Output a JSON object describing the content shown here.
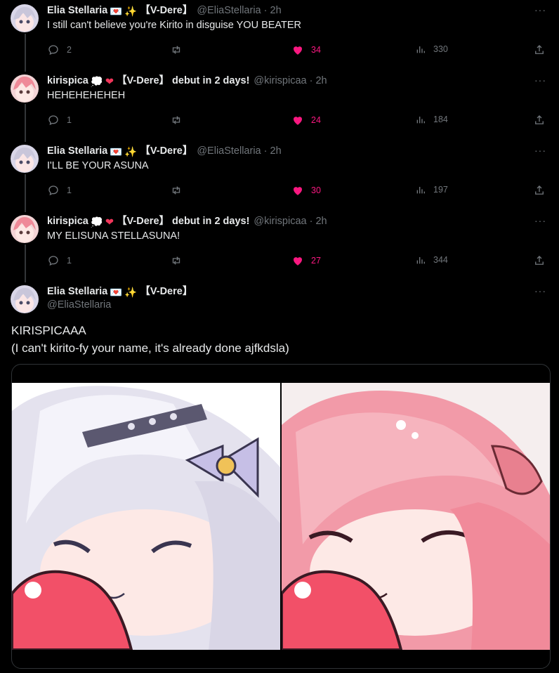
{
  "replies": [
    {
      "name": "Elia Stellaria",
      "emojis": [
        "💌",
        "✨"
      ],
      "tag": "【V-Dere】",
      "handle": "@EliaStellaria",
      "time": "2h",
      "text": "I still can't believe you're Kirito in disguise YOU BEATER",
      "replies": "2",
      "reposts": "",
      "likes": "34",
      "views": "330"
    },
    {
      "name": "kirispica",
      "emojis": [
        "💭",
        "❤"
      ],
      "tag": "【V-Dere】 debut in 2 days!",
      "handle": "@kirispicaa",
      "time": "2h",
      "text": "HEHEHEHEHEH",
      "replies": "1",
      "reposts": "",
      "likes": "24",
      "views": "184"
    },
    {
      "name": "Elia Stellaria",
      "emojis": [
        "💌",
        "✨"
      ],
      "tag": "【V-Dere】",
      "handle": "@EliaStellaria",
      "time": "2h",
      "text": "I'LL BE YOUR ASUNA",
      "replies": "1",
      "reposts": "",
      "likes": "30",
      "views": "197"
    },
    {
      "name": "kirispica",
      "emojis": [
        "💭",
        "❤"
      ],
      "tag": "【V-Dere】 debut in 2 days!",
      "handle": "@kirispicaa",
      "time": "2h",
      "text": "MY ELISUNA STELLASUNA!",
      "replies": "1",
      "reposts": "",
      "likes": "27",
      "views": "344"
    }
  ],
  "main": {
    "name": "Elia Stellaria",
    "emojis": [
      "💌",
      "✨"
    ],
    "tag": "【V-Dere】",
    "handle": "@EliaStellaria",
    "text_line1": "KIRISPICAAA",
    "text_line2": "(I can't kirito-fy your name, it's already done ajfkdsla)"
  },
  "more_glyph": "···",
  "dot": "·",
  "colors": {
    "like": "#f91880",
    "muted": "#71767b",
    "divider": "#2f3336"
  }
}
